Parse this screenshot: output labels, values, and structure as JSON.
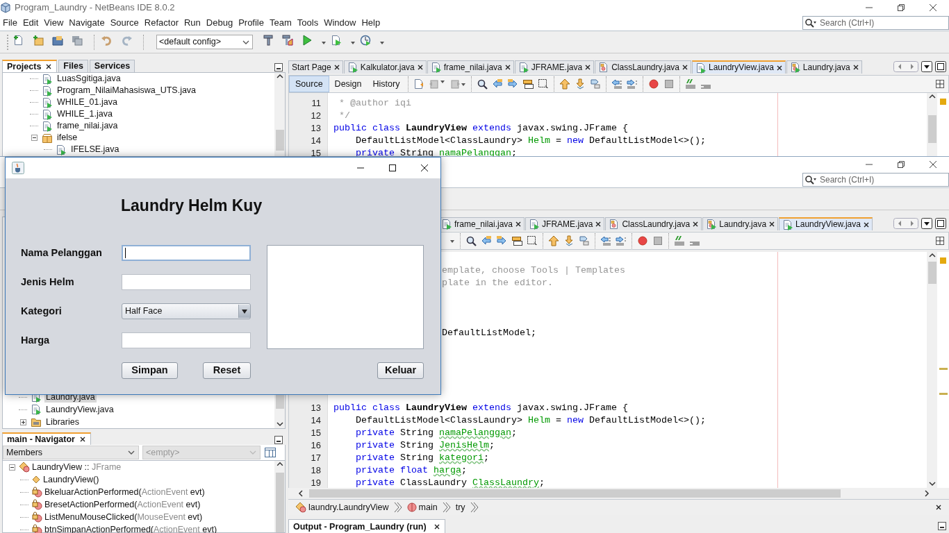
{
  "ide_back": {
    "title": "Program_Laundry - NetBeans IDE 8.0.2",
    "menu": [
      "File",
      "Edit",
      "View",
      "Navigate",
      "Source",
      "Refactor",
      "Run",
      "Debug",
      "Profile",
      "Team",
      "Tools",
      "Window",
      "Help"
    ],
    "search": {
      "placeholder": "Search (Ctrl+I)"
    },
    "config": "<default config>",
    "panel_tabs": [
      {
        "label": "Projects",
        "selected": true
      },
      {
        "label": "Files",
        "selected": false
      },
      {
        "label": "Services",
        "selected": false
      }
    ],
    "tree": [
      {
        "label": "LuasSgitiga.java",
        "kind": "file"
      },
      {
        "label": "Program_NilaiMahasiswa_UTS.java",
        "kind": "file"
      },
      {
        "label": "WHILE_01.java",
        "kind": "file"
      },
      {
        "label": "WHILE_1.java",
        "kind": "file"
      },
      {
        "label": "frame_nilai.java",
        "kind": "file"
      },
      {
        "label": "ifelse",
        "kind": "package",
        "expanded": true,
        "children": [
          {
            "label": "IFELSE.java",
            "kind": "file"
          }
        ]
      }
    ],
    "editor_tabs": [
      {
        "label": "Start Page",
        "kind": "page",
        "selected": false
      },
      {
        "label": "Kalkulator.java",
        "kind": "form",
        "selected": false
      },
      {
        "label": "frame_nilai.java",
        "kind": "form",
        "selected": false
      },
      {
        "label": "JFRAME.java",
        "kind": "form",
        "selected": false
      },
      {
        "label": "ClassLaundry.java",
        "kind": "class",
        "selected": false
      },
      {
        "label": "LaundryView.java",
        "kind": "form",
        "selected": true
      },
      {
        "label": "Laundry.java",
        "kind": "main",
        "selected": false
      }
    ],
    "view_tabs": [
      {
        "label": "Source",
        "selected": true
      },
      {
        "label": "Design",
        "selected": false
      },
      {
        "label": "History",
        "selected": false
      }
    ],
    "code": [
      {
        "kind": "numbered",
        "number": "11",
        "parts": [
          {
            "kind": "comment",
            "text": " * @author iqi"
          }
        ]
      },
      {
        "kind": "numbered",
        "number": "12",
        "parts": [
          {
            "kind": "comment",
            "text": " */"
          }
        ]
      },
      {
        "kind": "numbered",
        "number": "13",
        "parts": [
          {
            "kind": "keyword",
            "text": "public class "
          },
          {
            "kind": "declaration",
            "text": "LaundryView"
          },
          {
            "kind": "keyword",
            "text": " extends"
          },
          {
            "kind": "plain",
            "text": " javax.swing.JFrame {"
          }
        ]
      },
      {
        "kind": "numbered",
        "number": "14",
        "parts": [
          {
            "kind": "plain",
            "text": "    DefaultListModel<ClassLaundry> "
          },
          {
            "kind": "field",
            "text": "Helm"
          },
          {
            "kind": "plain",
            "text": " = "
          },
          {
            "kind": "keyword",
            "text": "new"
          },
          {
            "kind": "plain",
            "text": " DefaultListModel<>();"
          }
        ]
      },
      {
        "kind": "numbered",
        "number": "15",
        "parts": [
          {
            "kind": "keyword",
            "text": "    private"
          },
          {
            "kind": "plain",
            "text": " String "
          },
          {
            "kind": "unused_field",
            "text": "namaPelanggan"
          },
          {
            "kind": "plain",
            "text": ";"
          }
        ]
      }
    ]
  },
  "ide_front": {
    "search": {
      "placeholder": "Search (Ctrl+I)"
    },
    "tree": [
      {
        "label": "Laundry.java",
        "kind": "file",
        "selected": true
      },
      {
        "label": "LaundryView.java",
        "kind": "file",
        "selected": false
      },
      {
        "label": "Libraries",
        "kind": "library",
        "expanded": false,
        "selected": false
      }
    ],
    "navigator": {
      "title": "main - Navigator",
      "filter": "Members",
      "scope": "<empty>",
      "members": [
        {
          "kind": "class",
          "expanded": true,
          "parts": [
            {
              "kind": "plain",
              "text": "LaundryView :: "
            },
            {
              "kind": "type",
              "text": "JFrame"
            }
          ],
          "children": [
            {
              "kind": "constructor",
              "parts": [
                {
                  "kind": "plain",
                  "text": "LaundryView()"
                }
              ]
            },
            {
              "kind": "private_method",
              "parts": [
                {
                  "kind": "plain",
                  "text": "BkeluarActionPerformed("
                },
                {
                  "kind": "type",
                  "text": "ActionEvent"
                },
                {
                  "kind": "plain",
                  "text": " evt)"
                }
              ]
            },
            {
              "kind": "private_method",
              "parts": [
                {
                  "kind": "plain",
                  "text": "BresetActionPerformed("
                },
                {
                  "kind": "type",
                  "text": "ActionEvent"
                },
                {
                  "kind": "plain",
                  "text": " evt)"
                }
              ]
            },
            {
              "kind": "private_method",
              "parts": [
                {
                  "kind": "plain",
                  "text": "ListMenuMouseClicked("
                },
                {
                  "kind": "type",
                  "text": "MouseEvent"
                },
                {
                  "kind": "plain",
                  "text": " evt)"
                }
              ]
            },
            {
              "kind": "private_method",
              "parts": [
                {
                  "kind": "plain",
                  "text": "btnSimpanActionPerformed("
                },
                {
                  "kind": "type",
                  "text": "ActionEvent"
                },
                {
                  "kind": "plain",
                  "text": " evt)"
                }
              ]
            }
          ]
        }
      ]
    },
    "editor_tabs": [
      {
        "label": "frame_nilai.java",
        "kind": "form",
        "selected": false
      },
      {
        "label": "JFRAME.java",
        "kind": "form",
        "selected": false
      },
      {
        "label": "ClassLaundry.java",
        "kind": "class",
        "selected": false
      },
      {
        "label": "Laundry.java",
        "kind": "main",
        "selected": false
      },
      {
        "label": "LaundryView.java",
        "kind": "form",
        "selected": true
      }
    ],
    "code": [
      {
        "kind": "blank"
      },
      {
        "kind": "partial",
        "parts": [
          {
            "kind": "comment",
            "text": "emplate, choose Tools | Templates"
          }
        ]
      },
      {
        "kind": "partial",
        "parts": [
          {
            "kind": "comment",
            "text": "plate in the editor."
          }
        ]
      },
      {
        "kind": "blank"
      },
      {
        "kind": "blank"
      },
      {
        "kind": "blank"
      },
      {
        "kind": "partial",
        "parts": [
          {
            "kind": "plain",
            "text": "DefaultListModel;"
          }
        ]
      },
      {
        "kind": "blank"
      },
      {
        "kind": "blank"
      },
      {
        "kind": "blank"
      },
      {
        "kind": "blank"
      },
      {
        "kind": "blank"
      },
      {
        "kind": "numbered",
        "number": "13",
        "parts": [
          {
            "kind": "keyword",
            "text": "public class "
          },
          {
            "kind": "declaration",
            "text": "LaundryView"
          },
          {
            "kind": "keyword",
            "text": " extends"
          },
          {
            "kind": "plain",
            "text": " javax.swing.JFrame {"
          }
        ]
      },
      {
        "kind": "numbered",
        "number": "14",
        "parts": [
          {
            "kind": "plain",
            "text": "    DefaultListModel<ClassLaundry> "
          },
          {
            "kind": "field",
            "text": "Helm"
          },
          {
            "kind": "plain",
            "text": " = "
          },
          {
            "kind": "keyword",
            "text": "new"
          },
          {
            "kind": "plain",
            "text": " DefaultListModel<>();"
          }
        ]
      },
      {
        "kind": "numbered",
        "number": "15",
        "parts": [
          {
            "kind": "keyword",
            "text": "    private"
          },
          {
            "kind": "plain",
            "text": " String "
          },
          {
            "kind": "unused_field",
            "text": "namaPelanggan"
          },
          {
            "kind": "plain",
            "text": ";"
          }
        ]
      },
      {
        "kind": "numbered",
        "number": "16",
        "parts": [
          {
            "kind": "keyword",
            "text": "    private"
          },
          {
            "kind": "plain",
            "text": " String "
          },
          {
            "kind": "unused_field",
            "text": "JenisHelm"
          },
          {
            "kind": "plain",
            "text": ";"
          }
        ]
      },
      {
        "kind": "numbered",
        "number": "17",
        "parts": [
          {
            "kind": "keyword",
            "text": "    private"
          },
          {
            "kind": "plain",
            "text": " String "
          },
          {
            "kind": "unused_field",
            "text": "kategori"
          },
          {
            "kind": "plain",
            "text": ";"
          }
        ]
      },
      {
        "kind": "numbered",
        "number": "18",
        "parts": [
          {
            "kind": "keyword",
            "text": "    private float "
          },
          {
            "kind": "unused_field",
            "text": "harga"
          },
          {
            "kind": "plain",
            "text": ";"
          }
        ]
      },
      {
        "kind": "numbered",
        "number": "19",
        "parts": [
          {
            "kind": "keyword",
            "text": "    private"
          },
          {
            "kind": "plain",
            "text": " ClassLaundry "
          },
          {
            "kind": "unused_field",
            "text": "ClassLaundry"
          },
          {
            "kind": "plain",
            "text": ";"
          }
        ]
      }
    ],
    "breadcrumb": [
      {
        "label": "laundry.LaundryView",
        "kind": "class"
      },
      {
        "label": "main",
        "kind": "method"
      },
      {
        "label": "try",
        "kind": "block"
      }
    ],
    "output": {
      "title": "Output - Program_Laundry (run)"
    }
  },
  "dialog": {
    "heading": "Laundry Helm Kuy",
    "fields": [
      {
        "label": "Nama Pelanggan",
        "kind": "text",
        "focused": true
      },
      {
        "label": "Jenis Helm",
        "kind": "text",
        "focused": false
      },
      {
        "label": "Kategori",
        "kind": "combo",
        "value": "Half Face",
        "focused": false
      },
      {
        "label": "Harga",
        "kind": "text",
        "focused": false
      }
    ],
    "buttons": [
      "Simpan",
      "Reset",
      "Keluar"
    ]
  }
}
